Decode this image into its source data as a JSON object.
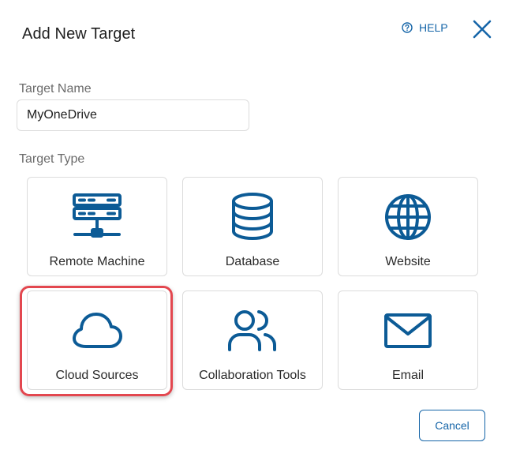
{
  "dialog": {
    "title": "Add New Target",
    "help_label": "HELP"
  },
  "target_name": {
    "label": "Target Name",
    "value": "MyOneDrive"
  },
  "target_type": {
    "label": "Target Type",
    "options": [
      {
        "label": "Remote Machine",
        "icon": "server-icon"
      },
      {
        "label": "Database",
        "icon": "database-icon"
      },
      {
        "label": "Website",
        "icon": "globe-icon"
      },
      {
        "label": "Cloud Sources",
        "icon": "cloud-icon",
        "highlighted": true
      },
      {
        "label": "Collaboration Tools",
        "icon": "users-icon"
      },
      {
        "label": "Email",
        "icon": "envelope-icon"
      }
    ]
  },
  "footer": {
    "cancel_label": "Cancel"
  },
  "colors": {
    "accent": "#1565a8",
    "icon": "#0c5b96",
    "highlight": "#e3474f",
    "border": "#dcdcdc"
  }
}
